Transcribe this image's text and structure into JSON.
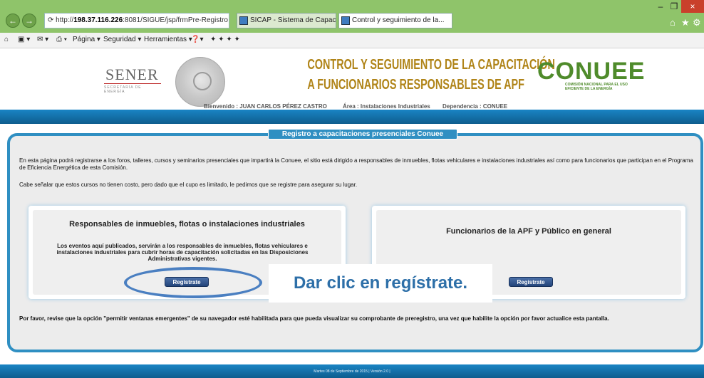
{
  "browser": {
    "address_prefix": "http://",
    "address_host": "198.37.116.226",
    "address_path": ":8081/SIGUE/jsp/frmPre-Registro",
    "tabs": [
      {
        "label": "SICAP - Sistema de Capacitación"
      },
      {
        "label": "Control y seguimiento de la..."
      }
    ],
    "toolbar": {
      "page_label": "Página ▾",
      "security_label": "Seguridad ▾",
      "tools_label": "Herramientas ▾"
    },
    "back_glyph": "←",
    "forward_glyph": "→",
    "refresh_glyph": "⟳",
    "search_glyph": "⌕",
    "close_glyph": "×",
    "minimize_glyph": "–",
    "restore_glyph": "❐",
    "home_glyph": "⌂",
    "star_glyph": "★",
    "gear_glyph": "⚙"
  },
  "header": {
    "sener_logo": "SENER",
    "sener_sub": "SECRETARÍA DE ENERGÍA",
    "title_line1": "CONTROL Y SEGUIMIENTO DE LA CAPACITACIÓN",
    "title_line2": "A FUNCIONARIOS RESPONSABLES DE APF",
    "conuee_logo": "CONUEE",
    "conuee_sub": "COMISIÓN NACIONAL PARA EL USO EFICIENTE DE LA ENERGÍA",
    "welcome": "Bienvenido : JUAN CARLOS PÉREZ CASTRO",
    "area": "Área : Instalaciones Industriales",
    "dependency": "Dependencia : CONUEE"
  },
  "main": {
    "panel_title": "Registro a capacitaciones presenciales Conuee",
    "intro": "En esta página podrá registrarse a los foros, talleres, cursos y seminarios presenciales que impartirá la Conuee, el sitio está dirigido a responsables de inmuebles, flotas vehiculares e instalaciones industriales así como para funcionarios que participan en el Programa de Eficiencia Energética de esta Comisión.",
    "intro2": "Cabe señalar que estos cursos no tienen costo, pero dado que el cupo es limitado, le pedimos que se registre para asegurar su lugar.",
    "card_left": {
      "title": "Responsables de inmuebles, flotas o instalaciones industriales",
      "body": "Los eventos aquí publicados, servirán a los responsables de inmuebles, flotas vehiculares e instalaciones industriales para cubrir horas de capacitación solicitadas en las Disposiciones Administrativas vigentes.",
      "button": "Regístrate"
    },
    "card_right": {
      "title": "Funcionarios de la APF y Público en general",
      "button": "Regístrate"
    },
    "callout": "Dar clic en regístrate.",
    "notice": "Por favor, revise que la opción \"permitir ventanas emergentes\" de su navegador esté habilitada para que pueda visualizar su comprobante de preregistro, una vez que habilite la opción por favor actualice esta pantalla."
  },
  "footer": {
    "text": "Martes 08 de Septiembre de 2015 | Versión 2.0 |"
  }
}
